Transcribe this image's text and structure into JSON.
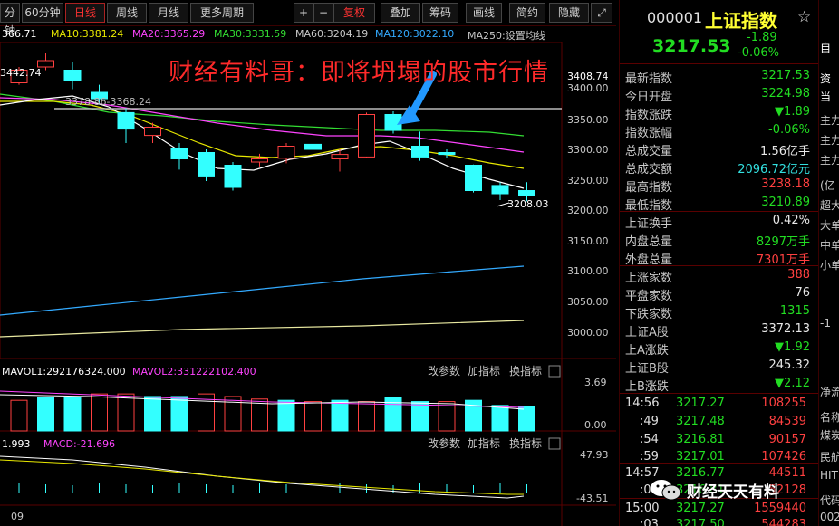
{
  "toolbar": {
    "period_min": "分钟",
    "period_60": "60分钟",
    "period_day": "日线",
    "period_week": "周线",
    "period_month": "月线",
    "period_more": "更多周期",
    "plus": "+",
    "minus": "−",
    "adjust": "复权",
    "overlay": "叠加",
    "chips": "筹码",
    "draw": "画线",
    "simple": "简约",
    "hide": "隐藏"
  },
  "ma_legend": {
    "ma5": "366.71",
    "ma10": "MA10:3381.24",
    "ma20": "MA20:3365.29",
    "ma30": "MA30:3331.59",
    "ma60": "MA60:3204.19",
    "ma120": "MA120:3022.10",
    "ma250": "MA250:设置均线"
  },
  "chart_labels": {
    "high_mark": "3442.74",
    "ref_line": "3378.86-3368.24",
    "low_mark": "3208.03",
    "price_ticks": [
      "3408.74",
      "3400.00",
      "3350.00",
      "3300.00",
      "3250.00",
      "3200.00",
      "3150.00",
      "3100.00",
      "3050.00",
      "3000.00"
    ],
    "vol_legend_1": "MAVOL1:292176324.000",
    "vol_legend_2": "MAVOL2:331222102.400",
    "vol_ticks": [
      "3.69",
      "0.00"
    ],
    "macd_legend_1": "1.993",
    "macd_legend_2": "MACD:-21.696",
    "macd_ticks": [
      "47.93",
      "-43.51"
    ],
    "btn_params": "改参数",
    "btn_add_ind": "加指标",
    "btn_switch_ind": "换指标",
    "date_label": "09"
  },
  "headline": "财经有料哥：即将坍塌的股市行情",
  "watermark": "财经天天有料",
  "chart_data": {
    "type": "candlestick",
    "candles": [
      {
        "open": 3395,
        "close": 3415,
        "high": 3420,
        "low": 3392
      },
      {
        "open": 3420,
        "close": 3430,
        "high": 3442.74,
        "low": 3415
      },
      {
        "open": 3415,
        "close": 3398,
        "high": 3428,
        "low": 3385
      },
      {
        "open": 3380,
        "close": 3370,
        "high": 3392,
        "low": 3362
      },
      {
        "open": 3348,
        "close": 3322,
        "high": 3355,
        "low": 3300
      },
      {
        "open": 3312,
        "close": 3325,
        "high": 3332,
        "low": 3300
      },
      {
        "open": 3292,
        "close": 3275,
        "high": 3300,
        "low": 3258
      },
      {
        "open": 3285,
        "close": 3248,
        "high": 3290,
        "low": 3240
      },
      {
        "open": 3265,
        "close": 3230,
        "high": 3270,
        "low": 3225
      },
      {
        "open": 3270,
        "close": 3275,
        "high": 3283,
        "low": 3263
      },
      {
        "open": 3276,
        "close": 3295,
        "high": 3300,
        "low": 3268
      },
      {
        "open": 3298,
        "close": 3290,
        "high": 3305,
        "low": 3283
      },
      {
        "open": 3275,
        "close": 3282,
        "high": 3290,
        "low": 3255
      },
      {
        "open": 3278,
        "close": 3345,
        "high": 3348,
        "low": 3276
      },
      {
        "open": 3345,
        "close": 3320,
        "high": 3350,
        "low": 3315
      },
      {
        "open": 3295,
        "close": 3278,
        "high": 3318,
        "low": 3272
      },
      {
        "open": 3285,
        "close": 3282,
        "high": 3290,
        "low": 3276
      },
      {
        "open": 3265,
        "close": 3225,
        "high": 3266,
        "low": 3222
      },
      {
        "open": 3233,
        "close": 3220,
        "high": 3238,
        "low": 3210
      },
      {
        "open": 3224.98,
        "close": 3217.53,
        "high": 3238.18,
        "low": 3208.03
      }
    ],
    "volumes": [
      2.4,
      2.6,
      2.6,
      2.9,
      2.9,
      2.7,
      2.7,
      2.9,
      2.7,
      2.5,
      2.4,
      2.3,
      2.4,
      2.3,
      2.6,
      2.3,
      2.3,
      2.4,
      2.0,
      1.9
    ],
    "vol_up": [
      true,
      false,
      false,
      true,
      true,
      false,
      false,
      true,
      true,
      true,
      false,
      true,
      false,
      true,
      false,
      false,
      true,
      false,
      false,
      false
    ],
    "ylim": [
      2960,
      3460
    ],
    "vol_ylim": [
      0,
      3.69
    ]
  },
  "index_header": {
    "code": "000001",
    "name": "上证指数",
    "price": "3217.53",
    "change": "-1.89",
    "change_pct": "-0.06%",
    "side_label": "自"
  },
  "quote_rows": [
    {
      "label": "最新指数",
      "value": "3217.53",
      "color": "green"
    },
    {
      "label": "今日开盘",
      "value": "3224.98",
      "color": "green"
    },
    {
      "label": "指数涨跌",
      "value": "▼1.89",
      "color": "green"
    },
    {
      "label": "指数涨幅",
      "value": "-0.06%",
      "color": "green"
    },
    {
      "label": "总成交量",
      "value": "1.56亿手",
      "color": "white"
    },
    {
      "label": "总成交额",
      "value": "2096.72亿元",
      "color": "cyan"
    },
    {
      "label": "最高指数",
      "value": "3238.18",
      "color": "red2"
    },
    {
      "label": "最低指数",
      "value": "3210.89",
      "color": "green"
    },
    {
      "label": "上证换手",
      "value": "0.42%",
      "color": "white"
    },
    {
      "label": "内盘总量",
      "value": "8297万手",
      "color": "green"
    },
    {
      "label": "外盘总量",
      "value": "7301万手",
      "color": "red2"
    },
    {
      "label": "上涨家数",
      "value": "388",
      "color": "red2"
    },
    {
      "label": "平盘家数",
      "value": "76",
      "color": "white"
    },
    {
      "label": "下跌家数",
      "value": "1315",
      "color": "green"
    },
    {
      "label": "上证A股",
      "value": "3372.13",
      "color": "white"
    },
    {
      "label": "上A涨跌",
      "value": "▼1.92",
      "color": "green"
    },
    {
      "label": "上证B股",
      "value": "245.32",
      "color": "white"
    },
    {
      "label": "上B涨跌",
      "value": "▼2.12",
      "color": "green"
    }
  ],
  "ticks": [
    {
      "time": "14:56",
      "price": "3217.27",
      "vol": "108255"
    },
    {
      "time": ":49",
      "price": "3217.48",
      "vol": "84539"
    },
    {
      "time": ":54",
      "price": "3216.81",
      "vol": "90157"
    },
    {
      "time": ":59",
      "price": "3217.01",
      "vol": "107426"
    },
    {
      "time": "14:57",
      "price": "3216.77",
      "vol": "44511"
    },
    {
      "time": ":08",
      "price": "3216.81",
      "vol": "52128"
    },
    {
      "time": "15:00",
      "price": "3217.27",
      "vol": "1559440"
    },
    {
      "time": ":03",
      "price": "3217.50",
      "vol": "544283"
    }
  ],
  "far_right": [
    "资",
    "当",
    "主力",
    "主力",
    "主力",
    "(亿",
    "超大",
    "大单",
    "中单",
    "小单",
    "-1",
    "净流",
    "名称",
    "煤炭",
    "民航",
    "HIT",
    "代码",
    "002"
  ]
}
